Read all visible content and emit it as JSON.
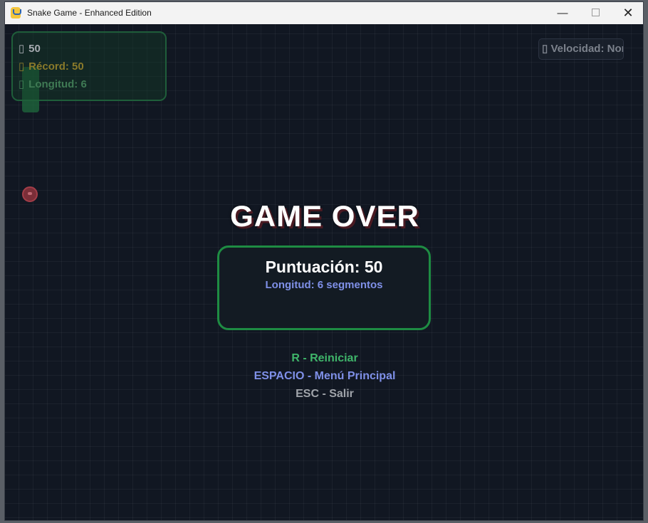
{
  "window": {
    "title": "Snake Game - Enhanced Edition",
    "app_icon": "pygame-snake-icon",
    "min_glyph": "—",
    "close_glyph": "✕"
  },
  "hud": {
    "score_icon": "▯",
    "score": "50",
    "record_icon": "▯",
    "record": "Récord: 50",
    "length_icon": "▯",
    "length": "Longitud: 6"
  },
  "speed": {
    "icon": "▯",
    "label": "Velocidad: Normal"
  },
  "game_over": {
    "title": "GAME OVER",
    "score": "Puntuación: 50",
    "length": "Longitud: 6 segmentos"
  },
  "options": {
    "restart": "R - Reiniciar",
    "menu": "ESPACIO - Menú Principal",
    "exit": "ESC - Salir"
  },
  "colors": {
    "background": "#111722",
    "accent_green": "#1e8c43",
    "accent_blue": "#7f90e8",
    "record_gold": "#8a7a2a"
  }
}
